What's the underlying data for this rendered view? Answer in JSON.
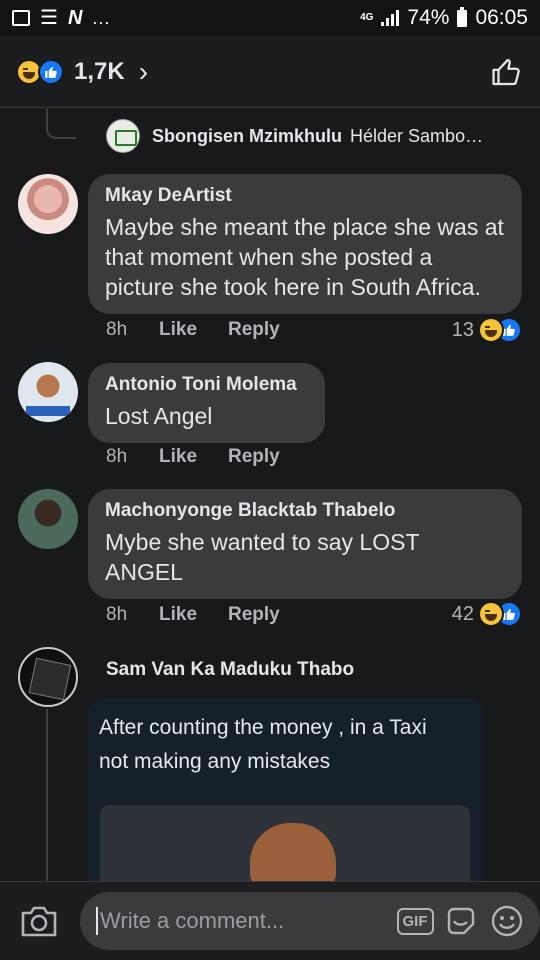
{
  "status_bar": {
    "network": "4G",
    "battery": "74%",
    "time": "06:05",
    "n_label": "N",
    "dots": "..."
  },
  "header": {
    "reaction_count": "1,7K"
  },
  "reply_preview": {
    "name": "Sbongisen Mzimkhulu",
    "preview": "Hélder Sambo…"
  },
  "comments": [
    {
      "name": "Mkay DeArtist",
      "text": "Maybe she meant the place she was at that moment when she posted a picture she took here in South Africa.",
      "time": "8h",
      "like": "Like",
      "reply": "Reply",
      "reactions": "13"
    },
    {
      "name": "Antonio Toni Molema",
      "text": "Lost Angel",
      "time": "8h",
      "like": "Like",
      "reply": "Reply"
    },
    {
      "name": "Machonyonge Blacktab Thabelo",
      "text": "Mybe she wanted to say LOST ANGEL",
      "time": "8h",
      "like": "Like",
      "reply": "Reply",
      "reactions": "42"
    },
    {
      "name": "Sam Van Ka Maduku Thabo",
      "media_text": "After counting the money , in a Taxi not making any mistakes"
    }
  ],
  "composer": {
    "placeholder": "Write a comment...",
    "gif_label": "GIF"
  }
}
